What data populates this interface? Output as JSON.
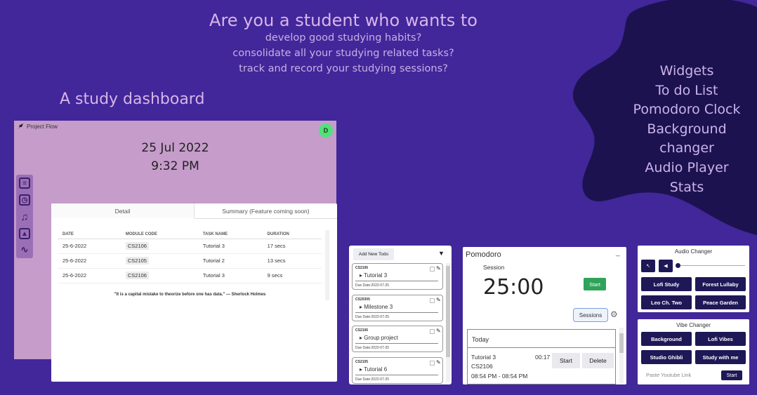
{
  "hero": {
    "title": "Are you a student who wants to",
    "lines": [
      "develop good studying habits?",
      "consolidate all your studying related tasks?",
      "track and record your studying sessions?"
    ]
  },
  "section_title": "A study dashboard",
  "widgets": [
    "Widgets",
    "To do List",
    "Pomodoro Clock",
    "Background changer",
    "Audio Player",
    "Stats"
  ],
  "dashboard": {
    "brand": "Project Flow",
    "avatar": "D",
    "date": "25 Jul 2022",
    "time": "9:32 PM",
    "dock_icons": [
      "notes-icon",
      "alarm-icon",
      "music-icon",
      "image-icon",
      "activity-icon"
    ],
    "tabs": [
      "Detail",
      "Summary (Feature coming soon)"
    ],
    "columns": [
      "DATE",
      "MODULE CODE",
      "TASK NAME",
      "DURATION"
    ],
    "rows": [
      [
        "25-6-2022",
        "CS2106",
        "Tutorial 3",
        "17 secs"
      ],
      [
        "25-6-2022",
        "CS2105",
        "Tutorial 2",
        "13 secs"
      ],
      [
        "25-6-2022",
        "CS2106",
        "Tutorial 3",
        "9 secs"
      ]
    ],
    "quote": "\"It is a capital mistake to theorize before one has data.\" — Sherlock Holmes"
  },
  "todo": {
    "add_label": "Add New Todo",
    "items": [
      {
        "code": "CS2106",
        "name": "Tutorial 3",
        "due": "Due Date:2022-07-25"
      },
      {
        "code": "CS20305",
        "name": "Milestone 3",
        "due": "Due Date:2022-07-25"
      },
      {
        "code": "CS2106",
        "name": "Group project",
        "due": "Due Date:2022-07-25"
      },
      {
        "code": "CS2105",
        "name": "Tutorial 6",
        "due": "Due Date:2022-07-25"
      }
    ]
  },
  "pomodoro": {
    "title": "Pomodoro",
    "minimize": "_",
    "session_label": "Session",
    "timer": "25:00",
    "start_label": "Start",
    "sessions_label": "Sessions",
    "today_label": "Today",
    "entry": {
      "task": "Tutorial 3",
      "time": "00:17",
      "code": "CS2106",
      "range": "08:54 PM - 08:54 PM",
      "start": "Start",
      "delete": "Delete"
    }
  },
  "audio": {
    "title": "Audio Changer",
    "tracks": [
      "Lofi Study",
      "Forest Lullaby",
      "Leo Ch. Two",
      "Peace Garden"
    ]
  },
  "vibe": {
    "title": "Vibe Changer",
    "options": [
      "Background",
      "Lofi Vibes",
      "Studio Ghibli",
      "Study with me"
    ],
    "input_placeholder": "Paste Youtube Link",
    "start_label": "Start"
  }
}
